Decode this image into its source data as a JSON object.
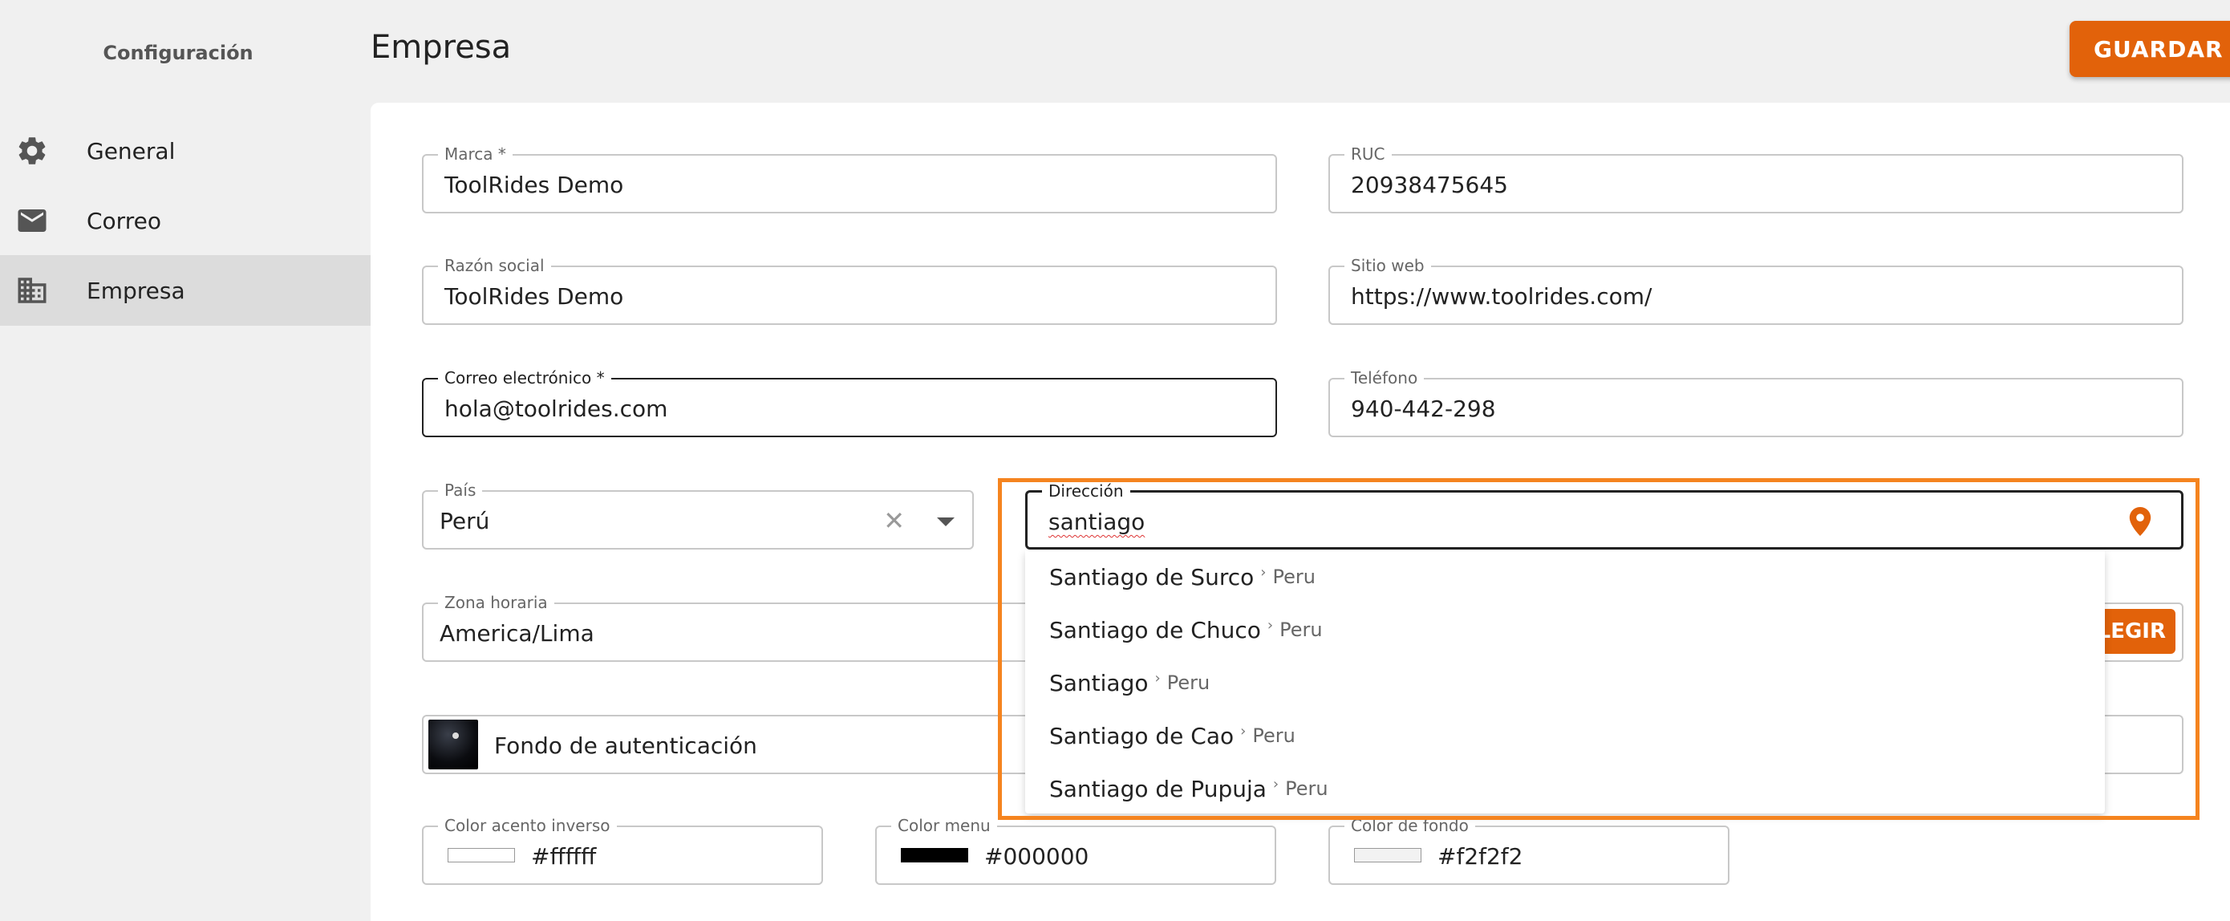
{
  "sidebar": {
    "title": "Configuración",
    "items": [
      {
        "label": "General",
        "icon": "gear-icon"
      },
      {
        "label": "Correo",
        "icon": "mail-icon"
      },
      {
        "label": "Empresa",
        "icon": "building-icon",
        "active": true
      }
    ]
  },
  "header": {
    "title": "Empresa",
    "save_label": "GUARDAR"
  },
  "form": {
    "marca": {
      "label": "Marca *",
      "value": "ToolRides Demo"
    },
    "ruc": {
      "label": "RUC",
      "value": "20938475645"
    },
    "razon_social": {
      "label": "Razón social",
      "value": "ToolRides Demo"
    },
    "sitio_web": {
      "label": "Sitio web",
      "value": "https://www.toolrides.com/"
    },
    "correo": {
      "label": "Correo electrónico *",
      "value": "hola@toolrides.com"
    },
    "telefono": {
      "label": "Teléfono",
      "value": "940-442-298"
    },
    "pais": {
      "label": "País",
      "value": "Perú"
    },
    "direccion": {
      "label": "Dirección",
      "value": "santiago"
    },
    "zona_horaria": {
      "label": "Zona horaria",
      "value": "America/Lima"
    },
    "choose_label": "LEGIR",
    "fondo": {
      "label": "Fondo de autenticación"
    },
    "color_acento_inverso": {
      "label": "Color acento inverso",
      "value": "#ffffff"
    },
    "color_menu": {
      "label": "Color menu",
      "value": "#000000"
    },
    "color_fondo": {
      "label": "Color de fondo",
      "value": "#f2f2f2"
    }
  },
  "suggestions": [
    {
      "place": "Santiago de Surco",
      "separator": "›",
      "country": "Peru"
    },
    {
      "place": "Santiago de Chuco",
      "separator": "›",
      "country": "Peru"
    },
    {
      "place": "Santiago",
      "separator": "›",
      "country": "Peru"
    },
    {
      "place": "Santiago de Cao",
      "separator": "›",
      "country": "Peru"
    },
    {
      "place": "Santiago de Pupuja",
      "separator": "›",
      "country": "Peru"
    }
  ],
  "colors": {
    "accent": "#e2620a",
    "highlight": "#f5841f",
    "sidebar_active": "#dcdcdc",
    "background": "#f0f0f0"
  }
}
